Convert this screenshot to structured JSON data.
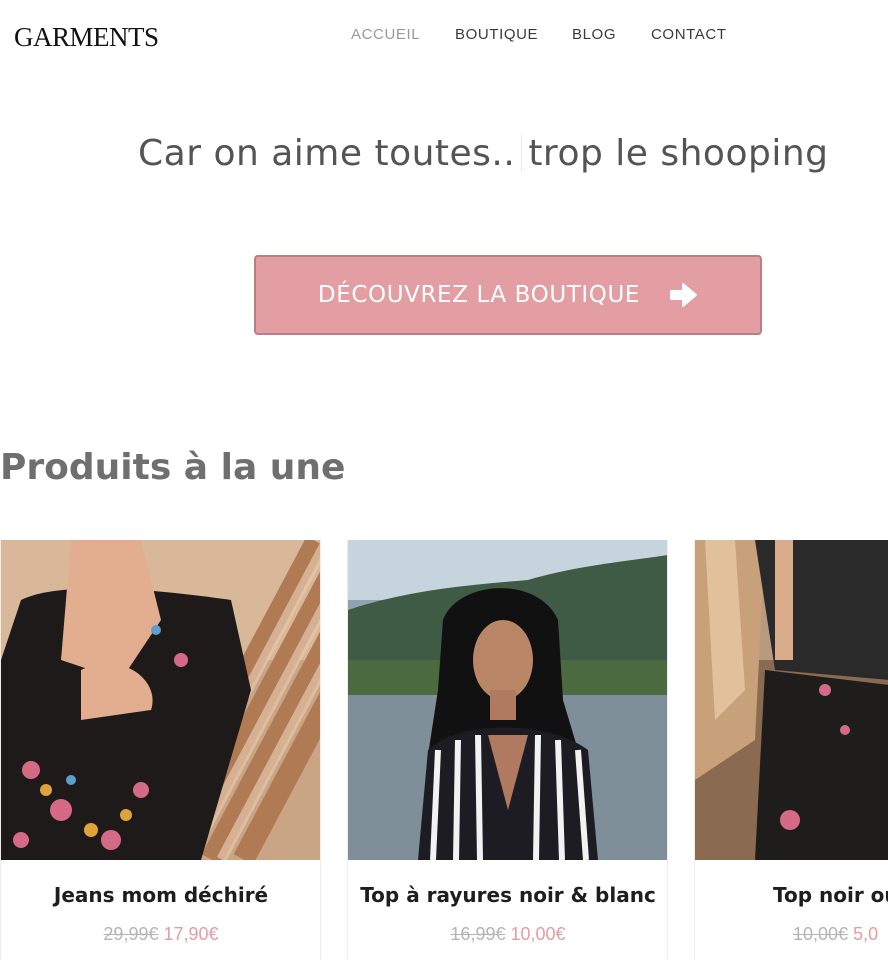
{
  "brand": "GARMENTS",
  "nav": {
    "items": [
      "ACCUEIL",
      "BOUTIQUE",
      "BLOG",
      "CONTACT"
    ],
    "active": "ACCUEIL"
  },
  "hero": {
    "title_part1": "Car on aime toutes..",
    "title_part2": "trop le shooping",
    "cta_label": "DÉCOUVREZ LA BOUTIQUE",
    "cta_icon": "arrow-right-icon"
  },
  "featured": {
    "title": "Produits à la une",
    "products": [
      {
        "name": "Jeans mom déchiré",
        "old_price": "29,99€",
        "price": "17,90€"
      },
      {
        "name": "Top à rayures noir & blanc",
        "old_price": "16,99€",
        "price": "10,00€"
      },
      {
        "name": "Top noir ou",
        "old_price": "10,00€",
        "price": "5,0"
      }
    ]
  },
  "colors": {
    "accent": "#e29ea2",
    "accent_border": "#b97f82",
    "heading": "#545454",
    "price_old": "#b5b5b5",
    "price_new": "#e29ea2"
  }
}
